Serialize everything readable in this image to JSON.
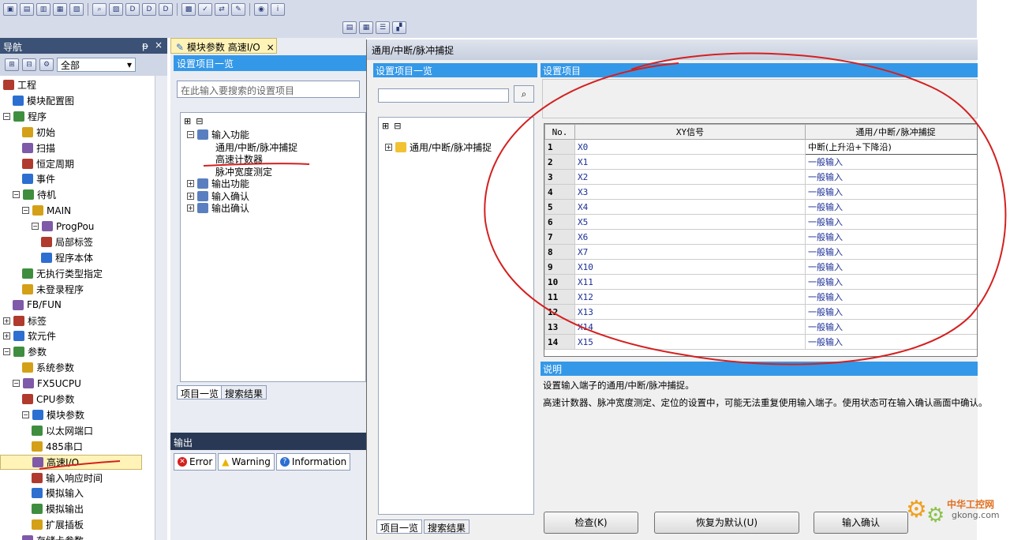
{
  "colors": {
    "nav_bg": "#293955",
    "header_blue": "#3498e8",
    "annotation_red": "#d42020",
    "tab_highlight": "#fff3b7"
  },
  "toolbar": {
    "icons": [
      "project-icon",
      "save-icon",
      "module-icon",
      "window-icon",
      "window2-icon",
      "binoculars-icon",
      "find-icon",
      "dev-icon",
      "dev2-icon",
      "dev3-icon",
      "doc-icon",
      "check-icon",
      "convert-icon",
      "tool-icon",
      "monitor-icon",
      "info-icon"
    ]
  },
  "nav": {
    "title": "导航",
    "pin": "ᵽ",
    "close": "×",
    "filter_value": "全部",
    "items": [
      {
        "label": "工程",
        "level": 0,
        "exp": ""
      },
      {
        "label": "模块配置图",
        "level": 1,
        "exp": ""
      },
      {
        "label": "程序",
        "level": 0,
        "exp": "−"
      },
      {
        "label": "初始",
        "level": 2,
        "exp": ""
      },
      {
        "label": "扫描",
        "level": 2,
        "exp": ""
      },
      {
        "label": "恒定周期",
        "level": 2,
        "exp": ""
      },
      {
        "label": "事件",
        "level": 2,
        "exp": ""
      },
      {
        "label": "待机",
        "level": 1,
        "exp": "−"
      },
      {
        "label": "MAIN",
        "level": 2,
        "exp": "−"
      },
      {
        "label": "ProgPou",
        "level": 3,
        "exp": "−"
      },
      {
        "label": "局部标签",
        "level": 4,
        "exp": ""
      },
      {
        "label": "程序本体",
        "level": 4,
        "exp": ""
      },
      {
        "label": "无执行类型指定",
        "level": 2,
        "exp": ""
      },
      {
        "label": "未登录程序",
        "level": 2,
        "exp": ""
      },
      {
        "label": "FB/FUN",
        "level": 1,
        "exp": ""
      },
      {
        "label": "标签",
        "level": 0,
        "exp": "+"
      },
      {
        "label": "软元件",
        "level": 0,
        "exp": "+"
      },
      {
        "label": "参数",
        "level": 0,
        "exp": "−"
      },
      {
        "label": "系统参数",
        "level": 2,
        "exp": ""
      },
      {
        "label": "FX5UCPU",
        "level": 1,
        "exp": "−"
      },
      {
        "label": "CPU参数",
        "level": 2,
        "exp": ""
      },
      {
        "label": "模块参数",
        "level": 2,
        "exp": "−"
      },
      {
        "label": "以太网端口",
        "level": 3,
        "exp": ""
      },
      {
        "label": "485串口",
        "level": 3,
        "exp": ""
      },
      {
        "label": "高速I/O",
        "level": 3,
        "exp": "",
        "selected": true
      },
      {
        "label": "输入响应时间",
        "level": 3,
        "exp": ""
      },
      {
        "label": "模拟输入",
        "level": 3,
        "exp": ""
      },
      {
        "label": "模拟输出",
        "level": 3,
        "exp": ""
      },
      {
        "label": "扩展插板",
        "level": 3,
        "exp": ""
      },
      {
        "label": "存储卡参数",
        "level": 2,
        "exp": ""
      }
    ]
  },
  "mid": {
    "tab_label": "模块参数 高速I/O",
    "tab_close": "×",
    "header": "设置项目一览",
    "search_placeholder": "在此输入要搜索的设置项目",
    "tree": [
      {
        "label": "输入功能",
        "exp": "−",
        "level": 0
      },
      {
        "label": "通用/中断/脉冲捕捉",
        "exp": "",
        "level": 1
      },
      {
        "label": "高速计数器",
        "exp": "",
        "level": 1
      },
      {
        "label": "脉冲宽度测定",
        "exp": "",
        "level": 1
      },
      {
        "label": "输出功能",
        "exp": "+",
        "level": 0
      },
      {
        "label": "输入确认",
        "exp": "+",
        "level": 0
      },
      {
        "label": "输出确认",
        "exp": "+",
        "level": 0
      }
    ],
    "tabs": [
      "项目一览",
      "搜索结果"
    ]
  },
  "output": {
    "title": "输出",
    "tabs": [
      {
        "label": "Error",
        "color": "#d42020",
        "glyph": "✕"
      },
      {
        "label": "Warning",
        "color": "#e8b400",
        "glyph": "!"
      },
      {
        "label": "Information",
        "color": "#2c6fd1",
        "glyph": "?"
      }
    ]
  },
  "dialog": {
    "title": "通用/中断/脉冲捕捉",
    "left_header": "设置项目一览",
    "right_header": "设置项目",
    "tree_item": "通用/中断/脉冲捕捉",
    "tabs": [
      "项目一览",
      "搜索结果"
    ],
    "grid": {
      "headers": [
        "No.",
        "XY信号",
        "通用/中断/脉冲捕捉"
      ],
      "rows": [
        {
          "no": "1",
          "sig": "X0",
          "val": "中断(上升沿+下降沿)"
        },
        {
          "no": "2",
          "sig": "X1",
          "val": "一般输入"
        },
        {
          "no": "3",
          "sig": "X2",
          "val": "一般输入"
        },
        {
          "no": "4",
          "sig": "X3",
          "val": "一般输入"
        },
        {
          "no": "5",
          "sig": "X4",
          "val": "一般输入"
        },
        {
          "no": "6",
          "sig": "X5",
          "val": "一般输入"
        },
        {
          "no": "7",
          "sig": "X6",
          "val": "一般输入"
        },
        {
          "no": "8",
          "sig": "X7",
          "val": "一般输入"
        },
        {
          "no": "9",
          "sig": "X10",
          "val": "一般输入"
        },
        {
          "no": "10",
          "sig": "X11",
          "val": "一般输入"
        },
        {
          "no": "11",
          "sig": "X12",
          "val": "一般输入"
        },
        {
          "no": "12",
          "sig": "X13",
          "val": "一般输入"
        },
        {
          "no": "13",
          "sig": "X14",
          "val": "一般输入"
        },
        {
          "no": "14",
          "sig": "X15",
          "val": "一般输入"
        }
      ]
    },
    "desc_header": "说明",
    "desc_lines": [
      "设置输入端子的通用/中断/脉冲捕捉。",
      "高速计数器、脉冲宽度测定、定位的设置中，可能无法重复使用输入端子。使用状态可在输入确认画面中确认。"
    ],
    "buttons": {
      "check": "检查(K)",
      "default": "恢复为默认(U)",
      "confirm": "输入确认"
    }
  },
  "watermark": {
    "cn": "中华工控网",
    "url": "gkong.com"
  }
}
